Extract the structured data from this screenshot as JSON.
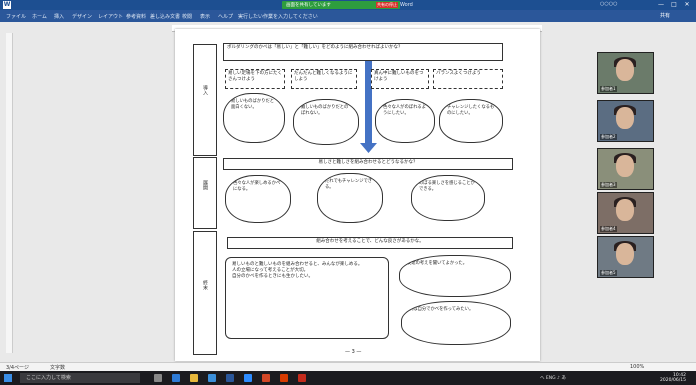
{
  "titlebar": {
    "doc_title": "指導案 - Word",
    "user": "○○○○",
    "min": "—",
    "max": "□",
    "close": "✕"
  },
  "share": {
    "label": "画面を共有しています",
    "stop": "共有の停止"
  },
  "ribbon": {
    "tabs": [
      "ファイル",
      "ホーム",
      "挿入",
      "デザイン",
      "レイアウト",
      "参考資料",
      "差し込み文書",
      "校閲",
      "表示",
      "ヘルプ",
      "実行したい作業を入力してください"
    ],
    "share": "共有"
  },
  "document": {
    "section1_label": "導入",
    "section2_label": "展開",
    "section3_label": "終末",
    "top_question": "ボルダリングのかべは「易しい」と「難しい」をどのように組み合わせればよいかな？",
    "dashed_boxes": [
      "易しい足場を下の方にたくさんつけよう",
      "だんだんと難しくなるようにしよう",
      "真ん中に難しいものをつけよう",
      "バランスよくつけよう"
    ],
    "clouds_row1": [
      "易しいものばかりだと面白くない。",
      "難しいものばかりだとのぼれない。",
      "色々な人がのぼれるようにしたい。",
      "チャレンジしたくなるものにしたい。"
    ],
    "question2": "易しさと難しさを組み合わせるとどうなるかな？",
    "clouds_row2": [
      "色々な人が楽しめるかべになる。",
      "だれでもチャレンジできる。",
      "のぼる楽しさを感じることができる。"
    ],
    "question3": "組み合わせを考えることで、どんな良さがあるかな。",
    "summary_list": [
      "易しいものと難しいものを組み合わせると、みんなが楽しめる。",
      "人の立場になって考えることが大切。",
      "自分のかべを作るときにも生かしたい。"
    ],
    "clouds_row3": [
      "友達の考えを聞いてよかった。",
      "次は自分でかべを作ってみたい。"
    ],
    "footer": "— 3 —"
  },
  "gallery": [
    {
      "name": "参加者1"
    },
    {
      "name": "参加者2"
    },
    {
      "name": "参加者3"
    },
    {
      "name": "参加者4"
    },
    {
      "name": "参加者5"
    }
  ],
  "statusbar": {
    "page": "3/4ページ",
    "words": "文字数",
    "zoom": "100%"
  },
  "taskbar": {
    "search_placeholder": "ここに入力して検索",
    "time": "10:42",
    "date": "2020/06/15",
    "tray": "へ ENG ♪ あ"
  }
}
